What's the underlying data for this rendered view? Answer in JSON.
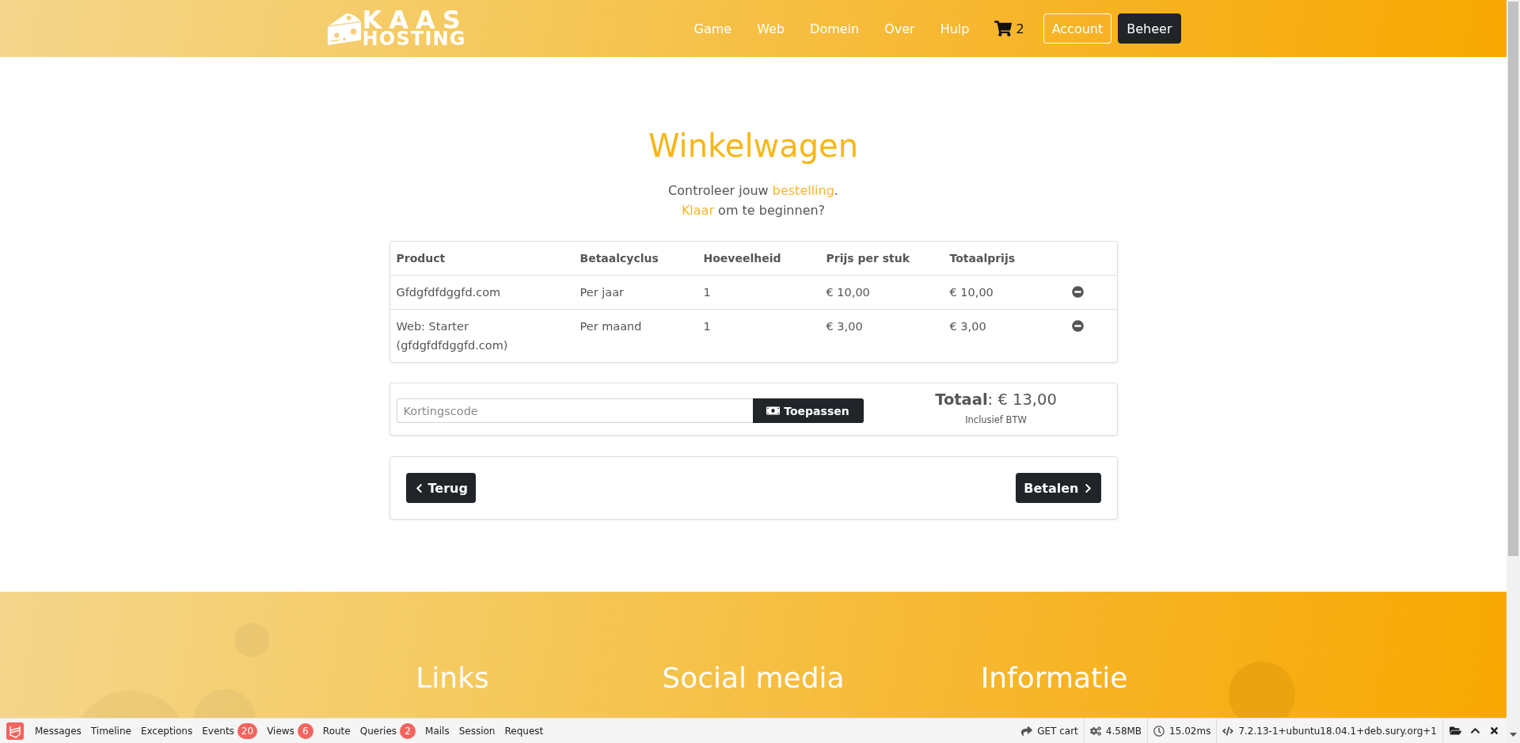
{
  "header": {
    "logo": {
      "line_1": "KAAS",
      "line_2": "HOSTING"
    },
    "nav": [
      "Game",
      "Web",
      "Domein",
      "Over",
      "Hulp"
    ],
    "cart_count": "2",
    "buttons": [
      {
        "label": "Account",
        "kind": "outline"
      },
      {
        "label": "Beheer",
        "kind": "solid"
      }
    ]
  },
  "page": {
    "title": "Winkelwagen",
    "intro": [
      {
        "parts": [
          {
            "text": "Controleer jouw ",
            "highlight": false
          },
          {
            "text": "bestelling",
            "highlight": true
          },
          {
            "text": ".",
            "highlight": false
          }
        ]
      },
      {
        "parts": [
          {
            "text": "Klaar",
            "highlight": true
          },
          {
            "text": " om te beginnen?",
            "highlight": false
          }
        ]
      }
    ]
  },
  "table": {
    "columns": [
      "Product",
      "Betaalcyclus",
      "Hoeveelheid",
      "Prijs per stuk",
      "Totaalprijs"
    ],
    "rows": [
      {
        "cells": [
          "Gfdgfdfdggfd.com",
          "Per jaar",
          "1",
          "€ 10,00",
          "€ 10,00"
        ]
      },
      {
        "cells": [
          "Web: Starter (gfdgfdfdggfd.com)",
          "Per maand",
          "1",
          "€ 3,00",
          "€ 3,00"
        ]
      }
    ]
  },
  "discount": {
    "placeholder": "Kortingscode",
    "button": "Toepassen",
    "total": "**Totaal**: € 13,00",
    "note": "Inclusief BTW"
  },
  "actions": {
    "back": "Terug",
    "next": "Betalen"
  },
  "footer": {
    "headings": [
      "Links",
      "Social media",
      "Informatie"
    ]
  },
  "debug_bar": {
    "tabs": [
      {
        "label": "Messages"
      },
      {
        "label": "Timeline"
      },
      {
        "label": "Exceptions"
      },
      {
        "label": "Events",
        "badge": "20"
      },
      {
        "label": "Views",
        "badge": "6"
      },
      {
        "label": "Route"
      },
      {
        "label": "Queries",
        "badge": "2"
      },
      {
        "label": "Mails"
      },
      {
        "label": "Session"
      },
      {
        "label": "Request"
      }
    ],
    "status": [
      {
        "kind": "route",
        "text": "GET cart"
      },
      {
        "kind": "memory",
        "text": "4.58MB"
      },
      {
        "kind": "time",
        "text": "15.02ms"
      },
      {
        "kind": "version",
        "text": "7.2.13-1+ubuntu18.04.1+deb.sury.org+1"
      }
    ]
  }
}
